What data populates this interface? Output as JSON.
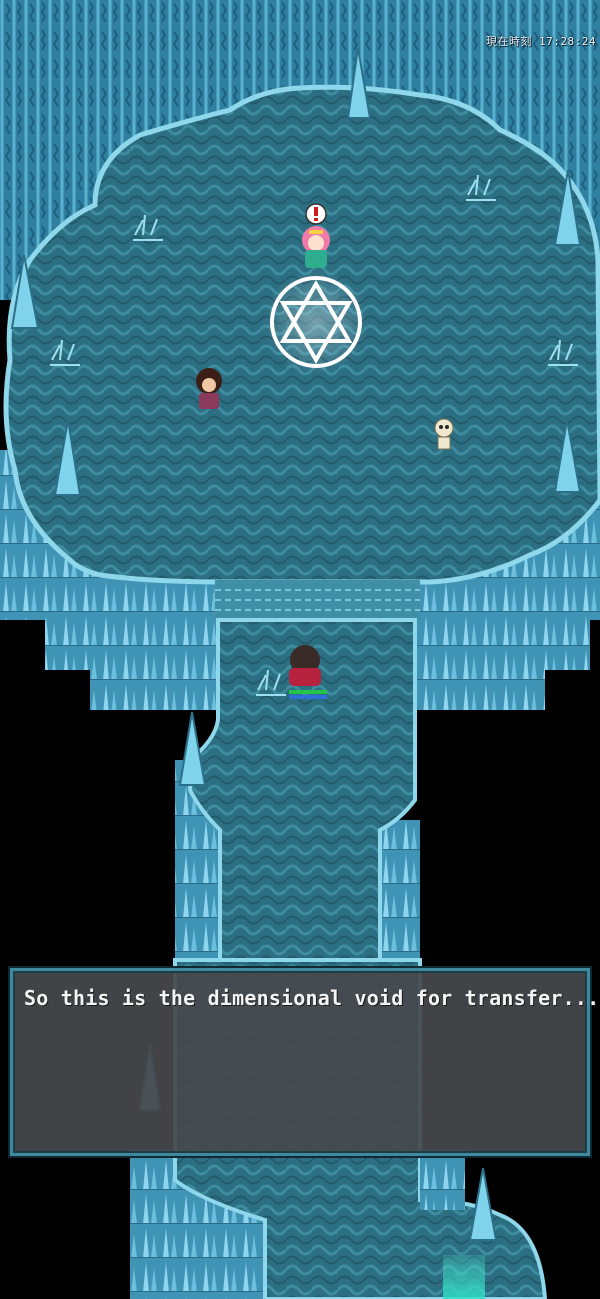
{
  "hud": {
    "clock_label": "現在時刻",
    "clock_time": "17:28:24"
  },
  "dialog": {
    "text": "So this is the dimensional void for transfer..."
  },
  "scene": {
    "background_color": "#000000",
    "wall_color": "#2f7fa0",
    "floor_color": "#2d6f82",
    "crystal_color": "#7fd3ea",
    "magic_circle_color": "#ffffff"
  },
  "characters": [
    {
      "name": "pink-haired-girl",
      "has_alert": true
    },
    {
      "name": "dark-haired-villager",
      "has_alert": false
    },
    {
      "name": "skeleton",
      "has_alert": false
    },
    {
      "name": "player-hero",
      "has_alert": false
    }
  ],
  "player_status": {
    "hp_fraction": 1.0,
    "mp_fraction": 1.0
  }
}
